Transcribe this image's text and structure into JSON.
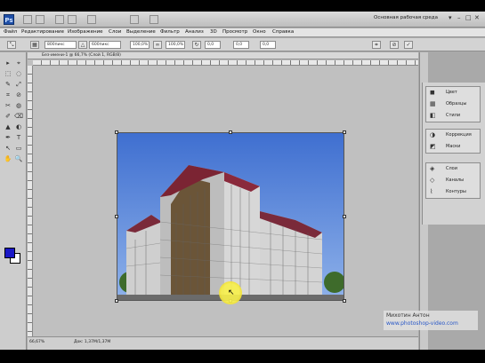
{
  "app": {
    "logo": "Ps",
    "workspace_label": "Основная рабочая среда",
    "window_controls": [
      "▾",
      "–",
      "□",
      "✕"
    ]
  },
  "menu": [
    "Файл",
    "Редактирование",
    "Изображение",
    "Слои",
    "Выделение",
    "Фильтр",
    "Анализ",
    "3D",
    "Просмотр",
    "Окно",
    "Справка"
  ],
  "options": {
    "width_value": "800пикс",
    "height_value": "600пикс",
    "field_3": "100,0%",
    "field_4": "100,0%",
    "angle_value": "0,0",
    "h_skew": "0,0",
    "v_skew": "0,0"
  },
  "document": {
    "tab_title": "Без-имени-1 @ 66,7% (Слой 1, RGB/8)",
    "zoom": "66,67%",
    "doc_info": "Док: 1,37М/1,37М"
  },
  "tools": [
    "▸",
    "⌖",
    "⬚",
    "◌",
    "✎",
    "⤢",
    "⌗",
    "⊘",
    "✂",
    "◍",
    "✐",
    "⌫",
    "▲",
    "◐",
    "✒",
    "T",
    "↖",
    "▭",
    "✋",
    "🔍"
  ],
  "panels": {
    "group1": [
      {
        "icon": "◼",
        "label": "Цвет"
      },
      {
        "icon": "▦",
        "label": "Образцы"
      },
      {
        "icon": "◧",
        "label": "Стили"
      }
    ],
    "group2": [
      {
        "icon": "◑",
        "label": "Коррекция"
      },
      {
        "icon": "◩",
        "label": "Маски"
      }
    ],
    "group3": [
      {
        "icon": "◈",
        "label": "Слои"
      },
      {
        "icon": "◇",
        "label": "Каналы"
      },
      {
        "icon": "⌇",
        "label": "Контуры"
      }
    ]
  },
  "watermark": {
    "name": "Михотин Антон",
    "url": "www.photoshop-video.com"
  },
  "colors": {
    "foreground": "#1a18c6",
    "background": "#ffffff",
    "sky": "#4a7ad0"
  }
}
